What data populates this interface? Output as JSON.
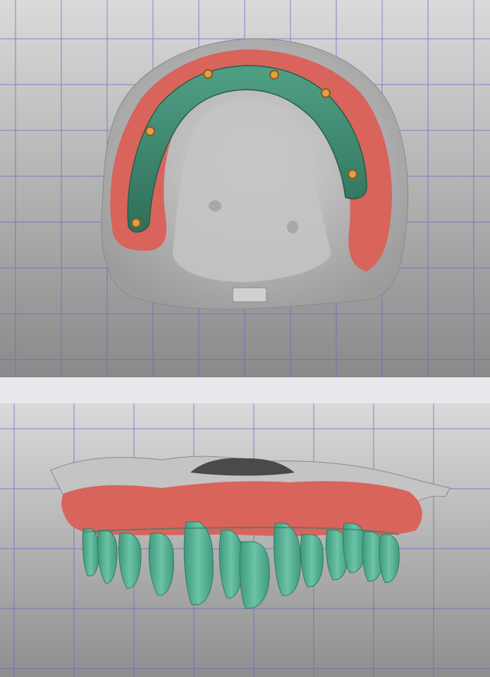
{
  "colors": {
    "background_light": "#d8d8d8",
    "background_dark": "#8c8c8c",
    "grid_line": "#6e63c8",
    "divider": "#e6e8ec",
    "gypsum": "#c8c8c8",
    "gingiva": "#d8645c",
    "framework": "#3f8a72",
    "teeth": "#5bb096",
    "implant_screw": "#e0a045"
  },
  "views": [
    {
      "id": "occlusal-view"
    },
    {
      "id": "frontal-view"
    }
  ]
}
